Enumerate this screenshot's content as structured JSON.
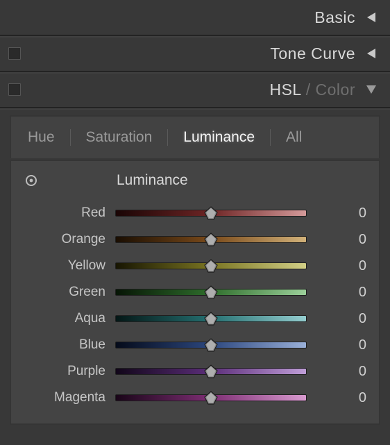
{
  "panels": {
    "basic": {
      "title": "Basic"
    },
    "tonecurve": {
      "title": "Tone Curve"
    },
    "hslcolor": {
      "prefix": "HSL",
      "sep": " / ",
      "suffix": "Color"
    }
  },
  "tabs": {
    "hue": "Hue",
    "saturation": "Saturation",
    "luminance": "Luminance",
    "all": "All",
    "active": "luminance"
  },
  "section": {
    "title": "Luminance"
  },
  "sliders": [
    {
      "name": "red",
      "label": "Red",
      "value": 0,
      "grad": "grad-red"
    },
    {
      "name": "orange",
      "label": "Orange",
      "value": 0,
      "grad": "grad-orange"
    },
    {
      "name": "yellow",
      "label": "Yellow",
      "value": 0,
      "grad": "grad-yellow"
    },
    {
      "name": "green",
      "label": "Green",
      "value": 0,
      "grad": "grad-green"
    },
    {
      "name": "aqua",
      "label": "Aqua",
      "value": 0,
      "grad": "grad-aqua"
    },
    {
      "name": "blue",
      "label": "Blue",
      "value": 0,
      "grad": "grad-blue"
    },
    {
      "name": "purple",
      "label": "Purple",
      "value": 0,
      "grad": "grad-purple"
    },
    {
      "name": "magenta",
      "label": "Magenta",
      "value": 0,
      "grad": "grad-magenta"
    }
  ]
}
